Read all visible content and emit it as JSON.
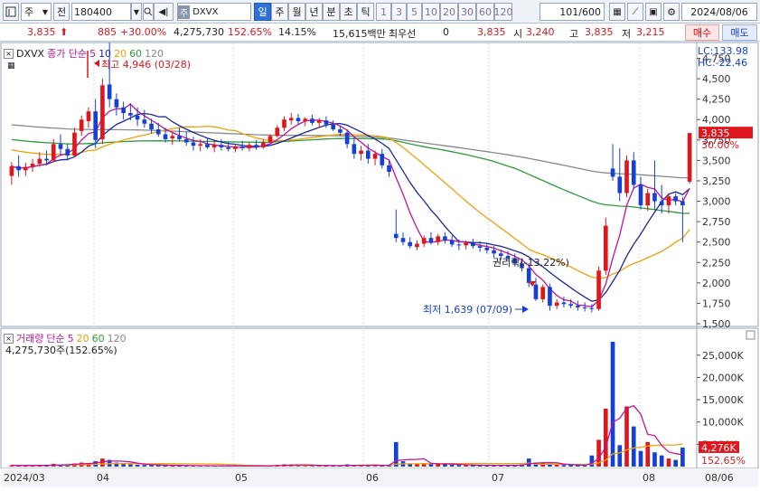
{
  "toolbar": {
    "market_combo": "주",
    "jeon_button": "전",
    "code_input": "180400",
    "name_input": "DXVX",
    "name_badge": "주",
    "period_tabs": [
      "일",
      "주",
      "월",
      "년",
      "분",
      "초",
      "틱"
    ],
    "active_period": "일",
    "interval_buttons": [
      "1",
      "3",
      "5",
      "10",
      "20",
      "30",
      "60",
      "120"
    ],
    "count_display": "101/600",
    "date_input": "2024/08/06"
  },
  "quote": {
    "price": "3,835",
    "change": "885",
    "change_pct": "+30.00%",
    "volume": "4,275,730",
    "volume_ratio": "152.65%",
    "turnover": "14.15%",
    "amount": "15,615백만",
    "priority_label": "최우선",
    "priority_value": "0",
    "ask": "3,835",
    "open_label": "시",
    "open": "3,240",
    "high_label": "고",
    "high": "3,835",
    "low_label": "저",
    "low": "3,215",
    "buy_button": "매수",
    "sell_button": "매도"
  },
  "colors": {
    "up": "#e0161d",
    "down": "#1440d8",
    "ma5": "#c3139b",
    "ma10": "#1a2a9c",
    "ma20": "#f0a10a",
    "ma60": "#2f9c3a",
    "ma120": "#888888",
    "toolbar_bg": "#eef1f6",
    "accent": "#2f6fd6"
  },
  "price_panel": {
    "legend_code": "DXVX",
    "legend_prefix": "종가 단순",
    "ma_periods": [
      "5",
      "10",
      "20",
      "60",
      "120"
    ],
    "lc_label": "LC:133.98",
    "hc_label": "HC:-22.46",
    "high_note": "최고 4,946 (03/28)",
    "low_note": "최저 1,639 (07/09)",
    "rights_note": "권리락(-13.22%)",
    "current_price_tag": "3,835",
    "current_pct_tag": "30.00%",
    "y_ticks": [
      "4,750",
      "4,500",
      "4,250",
      "4,000",
      "3,750",
      "3,500",
      "3,250",
      "3,000",
      "2,750",
      "2,500",
      "2,250",
      "2,000",
      "1,750",
      "1,500"
    ]
  },
  "volume_panel": {
    "legend_title": "거래량",
    "legend_prefix": "단순",
    "ma_periods": [
      "5",
      "20",
      "60",
      "120"
    ],
    "summary": "4,275,730주(152.65%)",
    "current_tag": "4,276K",
    "current_pct": "152.65%",
    "y_ticks": [
      "25,000K",
      "20,000K",
      "15,000K",
      "10,000K",
      "5,000K"
    ]
  },
  "x_labels": [
    "2024/03",
    "04",
    "05",
    "06",
    "07",
    "08",
    "08/06"
  ],
  "chart_data": {
    "type": "candlestick",
    "price_ylim": [
      1500,
      4800
    ],
    "volume_ylim": [
      0,
      28000
    ],
    "candles": [
      [
        3310,
        3480,
        3200,
        3430
      ],
      [
        3430,
        3560,
        3300,
        3380
      ],
      [
        3380,
        3470,
        3310,
        3420
      ],
      [
        3420,
        3520,
        3360,
        3460
      ],
      [
        3460,
        3600,
        3420,
        3520
      ],
      [
        3520,
        3620,
        3440,
        3500
      ],
      [
        3500,
        3760,
        3480,
        3700
      ],
      [
        3700,
        3820,
        3560,
        3640
      ],
      [
        3640,
        3700,
        3500,
        3560
      ],
      [
        3560,
        3900,
        3540,
        3840
      ],
      [
        3860,
        4050,
        3800,
        4000
      ],
      [
        3980,
        4150,
        3900,
        4100
      ],
      [
        4100,
        4250,
        3650,
        3750
      ],
      [
        3760,
        4500,
        3700,
        4420
      ],
      [
        4430,
        4946,
        4150,
        4250
      ],
      [
        4250,
        4320,
        4050,
        4150
      ],
      [
        4150,
        4220,
        4000,
        4080
      ],
      [
        4080,
        4200,
        3990,
        4050
      ],
      [
        4050,
        4150,
        3920,
        4000
      ],
      [
        4000,
        4120,
        3900,
        3950
      ],
      [
        3950,
        4010,
        3830,
        3880
      ],
      [
        3880,
        3960,
        3790,
        3820
      ],
      [
        3820,
        3900,
        3720,
        3760
      ],
      [
        3770,
        3850,
        3690,
        3800
      ],
      [
        3800,
        3900,
        3730,
        3760
      ],
      [
        3760,
        3850,
        3680,
        3720
      ],
      [
        3720,
        3790,
        3620,
        3680
      ],
      [
        3680,
        3760,
        3610,
        3700
      ],
      [
        3700,
        3780,
        3640,
        3660
      ],
      [
        3660,
        3740,
        3600,
        3690
      ],
      [
        3690,
        3760,
        3620,
        3660
      ],
      [
        3660,
        3730,
        3610,
        3640
      ],
      [
        3640,
        3700,
        3600,
        3670
      ],
      [
        3670,
        3740,
        3620,
        3650
      ],
      [
        3650,
        3720,
        3610,
        3690
      ],
      [
        3690,
        3750,
        3630,
        3660
      ],
      [
        3660,
        3760,
        3640,
        3720
      ],
      [
        3720,
        3820,
        3700,
        3800
      ],
      [
        3800,
        3930,
        3780,
        3900
      ],
      [
        3900,
        4040,
        3860,
        4000
      ],
      [
        3990,
        4080,
        3940,
        4020
      ],
      [
        4020,
        4070,
        3940,
        3980
      ],
      [
        3980,
        4030,
        3920,
        4010
      ],
      [
        4010,
        4060,
        3930,
        3960
      ],
      [
        3960,
        4020,
        3900,
        3990
      ],
      [
        3990,
        4040,
        3900,
        3940
      ],
      [
        3940,
        3990,
        3860,
        3880
      ],
      [
        3880,
        3930,
        3800,
        3840
      ],
      [
        3840,
        3880,
        3650,
        3700
      ],
      [
        3700,
        3780,
        3520,
        3580
      ],
      [
        3580,
        3680,
        3500,
        3620
      ],
      [
        3620,
        3700,
        3460,
        3520
      ],
      [
        3520,
        3620,
        3440,
        3580
      ],
      [
        3580,
        3640,
        3400,
        3440
      ],
      [
        3440,
        3500,
        3300,
        3360
      ],
      [
        2600,
        2900,
        2500,
        2550
      ],
      [
        2550,
        2620,
        2460,
        2500
      ],
      [
        2500,
        2560,
        2420,
        2450
      ],
      [
        2440,
        2520,
        2400,
        2480
      ],
      [
        2480,
        2580,
        2440,
        2550
      ],
      [
        2550,
        2620,
        2470,
        2500
      ],
      [
        2500,
        2600,
        2460,
        2570
      ],
      [
        2570,
        2620,
        2480,
        2520
      ],
      [
        2520,
        2580,
        2440,
        2470
      ],
      [
        2470,
        2530,
        2400,
        2460
      ],
      [
        2460,
        2520,
        2410,
        2490
      ],
      [
        2490,
        2540,
        2420,
        2450
      ],
      [
        2450,
        2510,
        2380,
        2430
      ],
      [
        2430,
        2480,
        2360,
        2400
      ],
      [
        2400,
        2450,
        2310,
        2360
      ],
      [
        2360,
        2410,
        2280,
        2330
      ],
      [
        2330,
        2390,
        2260,
        2300
      ],
      [
        2300,
        2360,
        2200,
        2240
      ],
      [
        2240,
        2300,
        2140,
        2180
      ],
      [
        2180,
        2240,
        1950,
        2000
      ],
      [
        1980,
        2060,
        1780,
        1800
      ],
      [
        1800,
        1980,
        1760,
        1950
      ],
      [
        1950,
        1990,
        1660,
        1720
      ],
      [
        1720,
        1800,
        1680,
        1760
      ],
      [
        1760,
        1830,
        1700,
        1740
      ],
      [
        1740,
        1800,
        1690,
        1720
      ],
      [
        1720,
        1780,
        1660,
        1700
      ],
      [
        1700,
        1760,
        1650,
        1690
      ],
      [
        1690,
        1740,
        1639,
        1680
      ],
      [
        1680,
        2200,
        1660,
        2150
      ],
      [
        2150,
        2800,
        2100,
        2700
      ],
      [
        3400,
        3700,
        3250,
        3300
      ],
      [
        3300,
        3650,
        3000,
        3100
      ],
      [
        3100,
        3560,
        3050,
        3500
      ],
      [
        3500,
        3600,
        3150,
        3200
      ],
      [
        3200,
        3300,
        2900,
        2950
      ],
      [
        2950,
        3150,
        2880,
        3100
      ],
      [
        3100,
        3500,
        2900,
        3000
      ],
      [
        3000,
        3200,
        2850,
        2950
      ],
      [
        2950,
        3100,
        2850,
        3060
      ],
      [
        3060,
        3100,
        2950,
        3000
      ],
      [
        3000,
        3050,
        2500,
        2950
      ],
      [
        3240,
        3835,
        3215,
        3835
      ]
    ],
    "volume": [
      300,
      200,
      250,
      200,
      350,
      300,
      600,
      400,
      500,
      700,
      900,
      800,
      1200,
      1800,
      1500,
      900,
      600,
      500,
      400,
      350,
      300,
      250,
      280,
      250,
      220,
      200,
      200,
      180,
      170,
      160,
      150,
      150,
      140,
      150,
      140,
      140,
      160,
      250,
      380,
      500,
      450,
      300,
      250,
      230,
      200,
      220,
      180,
      170,
      500,
      400,
      300,
      280,
      260,
      300,
      250,
      5500,
      1200,
      700,
      500,
      800,
      600,
      550,
      500,
      400,
      350,
      300,
      300,
      250,
      280,
      300,
      250,
      220,
      400,
      500,
      1800,
      900,
      700,
      500,
      400,
      350,
      300,
      250,
      220,
      2500,
      6000,
      13000,
      28000,
      4800,
      13500,
      9000,
      3500,
      5500,
      3200,
      2500,
      1800,
      1500,
      4276
    ],
    "ma": {
      "ma5_label": "5",
      "ma10_label": "10",
      "ma20_label": "20",
      "ma60_label": "60",
      "ma120_label": "120"
    }
  }
}
